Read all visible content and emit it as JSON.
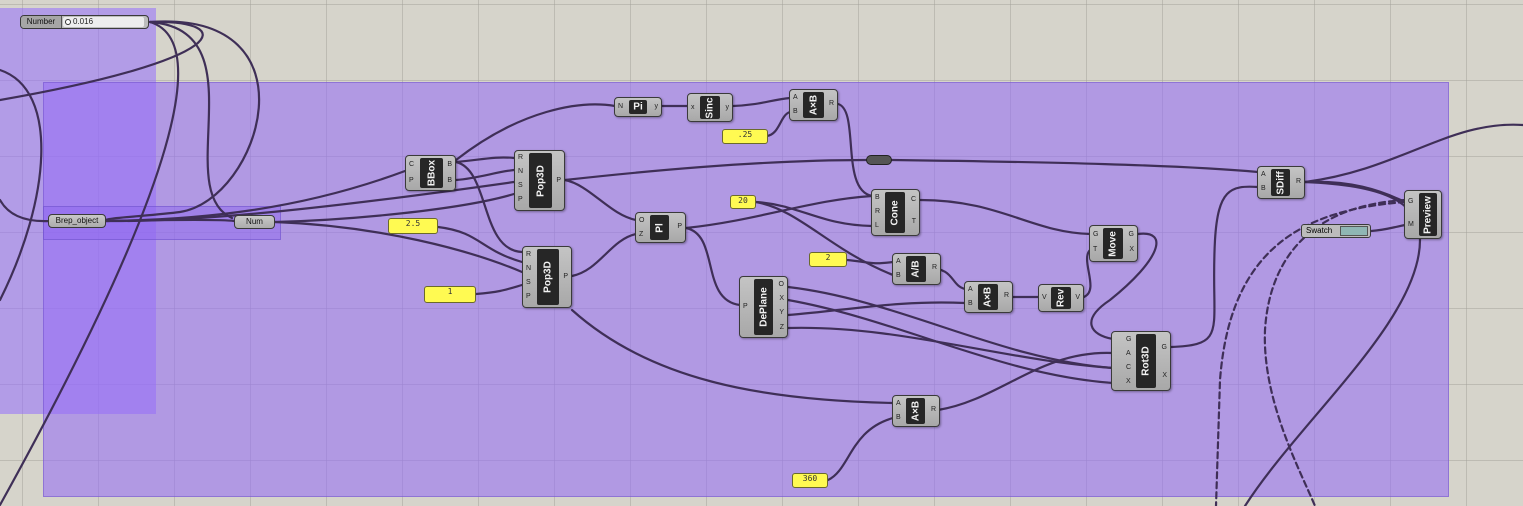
{
  "canvas": {
    "background": "#d6d4cb",
    "group_color": "#a382f2"
  },
  "slider": {
    "label": "Number",
    "value": "0.016"
  },
  "brep_param": {
    "label": "Brep_object"
  },
  "num_param": {
    "label": "Num"
  },
  "swatch": {
    "label": "Swatch",
    "color": "#8fb6b4"
  },
  "panels": {
    "p_025": ".25",
    "p_25": "2.5",
    "p_1": "1",
    "p_20": "20",
    "p_2": "2",
    "p_360": "360"
  },
  "components": {
    "bbox": {
      "title": "BBox",
      "inputs": [
        "C",
        "P"
      ],
      "outputs": [
        "B",
        "B"
      ]
    },
    "pop3d_a": {
      "title": "Pop3D",
      "inputs": [
        "R",
        "N",
        "S",
        "P"
      ],
      "outputs": [
        "P"
      ]
    },
    "pop3d_b": {
      "title": "Pop3D",
      "inputs": [
        "R",
        "N",
        "S",
        "P"
      ],
      "outputs": [
        "P"
      ]
    },
    "pi": {
      "title": "Pi",
      "inputs": [
        "N"
      ],
      "outputs": [
        "y"
      ]
    },
    "sinc": {
      "title": "Sinc",
      "inputs": [
        "x"
      ],
      "outputs": [
        "y"
      ]
    },
    "mult_top": {
      "title": "A×B",
      "inputs": [
        "A",
        "B"
      ],
      "outputs": [
        "R"
      ]
    },
    "pl": {
      "title": "Pl",
      "inputs": [
        "O",
        "Z"
      ],
      "outputs": [
        "P"
      ]
    },
    "cone": {
      "title": "Cone",
      "inputs": [
        "B",
        "R",
        "L"
      ],
      "outputs": [
        "C",
        "T"
      ]
    },
    "deplane": {
      "title": "DePlane",
      "inputs": [
        "P"
      ],
      "outputs": [
        "O",
        "X",
        "Y",
        "Z"
      ]
    },
    "div": {
      "title": "A/B",
      "inputs": [
        "A",
        "B"
      ],
      "outputs": [
        "R"
      ]
    },
    "mult_mid": {
      "title": "A×B",
      "inputs": [
        "A",
        "B"
      ],
      "outputs": [
        "R"
      ]
    },
    "rev": {
      "title": "Rev",
      "inputs": [
        "V"
      ],
      "outputs": [
        "V"
      ]
    },
    "move": {
      "title": "Move",
      "inputs": [
        "G",
        "T"
      ],
      "outputs": [
        "G",
        "X"
      ]
    },
    "rot3d": {
      "title": "Rot3D",
      "inputs": [
        "G",
        "A",
        "C",
        "X"
      ],
      "outputs": [
        "G",
        "X"
      ]
    },
    "mult_bot": {
      "title": "A×B",
      "inputs": [
        "A",
        "B"
      ],
      "outputs": [
        "R"
      ]
    },
    "sdiff": {
      "title": "SDiff",
      "inputs": [
        "A",
        "B"
      ],
      "outputs": [
        "R"
      ]
    },
    "preview": {
      "title": "Preview",
      "inputs": [
        "G",
        "M"
      ],
      "outputs": []
    }
  }
}
